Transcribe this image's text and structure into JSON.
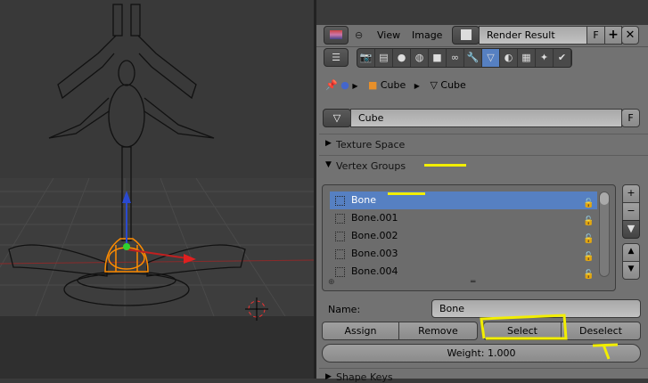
{
  "header": {
    "menu_view": "View",
    "menu_image": "Image",
    "image_name": "Render Result",
    "fake_user": "F"
  },
  "property_tabs": [
    {
      "icon": "camera-render-icon",
      "active": false
    },
    {
      "icon": "render-layers-icon",
      "active": false
    },
    {
      "icon": "scene-icon",
      "active": false
    },
    {
      "icon": "world-icon",
      "active": false
    },
    {
      "icon": "object-icon",
      "active": false
    },
    {
      "icon": "constraints-icon",
      "active": false
    },
    {
      "icon": "modifiers-icon",
      "active": false
    },
    {
      "icon": "mesh-data-icon",
      "active": true
    },
    {
      "icon": "material-icon",
      "active": false
    },
    {
      "icon": "texture-icon",
      "active": false
    },
    {
      "icon": "particles-icon",
      "active": false
    },
    {
      "icon": "physics-icon",
      "active": false
    }
  ],
  "breadcrumb": {
    "object": "Cube",
    "mesh": "Cube"
  },
  "datablock": {
    "name": "Cube",
    "fake_user": "F"
  },
  "sections": {
    "texture_space": "Texture Space",
    "vertex_groups": "Vertex Groups",
    "shape_keys": "Shape Keys"
  },
  "vertex_groups": [
    {
      "name": "Bone",
      "selected": true
    },
    {
      "name": "Bone.001",
      "selected": false
    },
    {
      "name": "Bone.002",
      "selected": false
    },
    {
      "name": "Bone.003",
      "selected": false
    },
    {
      "name": "Bone.004",
      "selected": false
    }
  ],
  "name_label": "Name:",
  "name_value": "Bone",
  "buttons": {
    "assign": "Assign",
    "remove": "Remove",
    "select": "Select",
    "deselect": "Deselect"
  },
  "weight": "Weight: 1.000",
  "colors": {
    "accent": "#5680c2",
    "annotation": "#f2ee00"
  }
}
